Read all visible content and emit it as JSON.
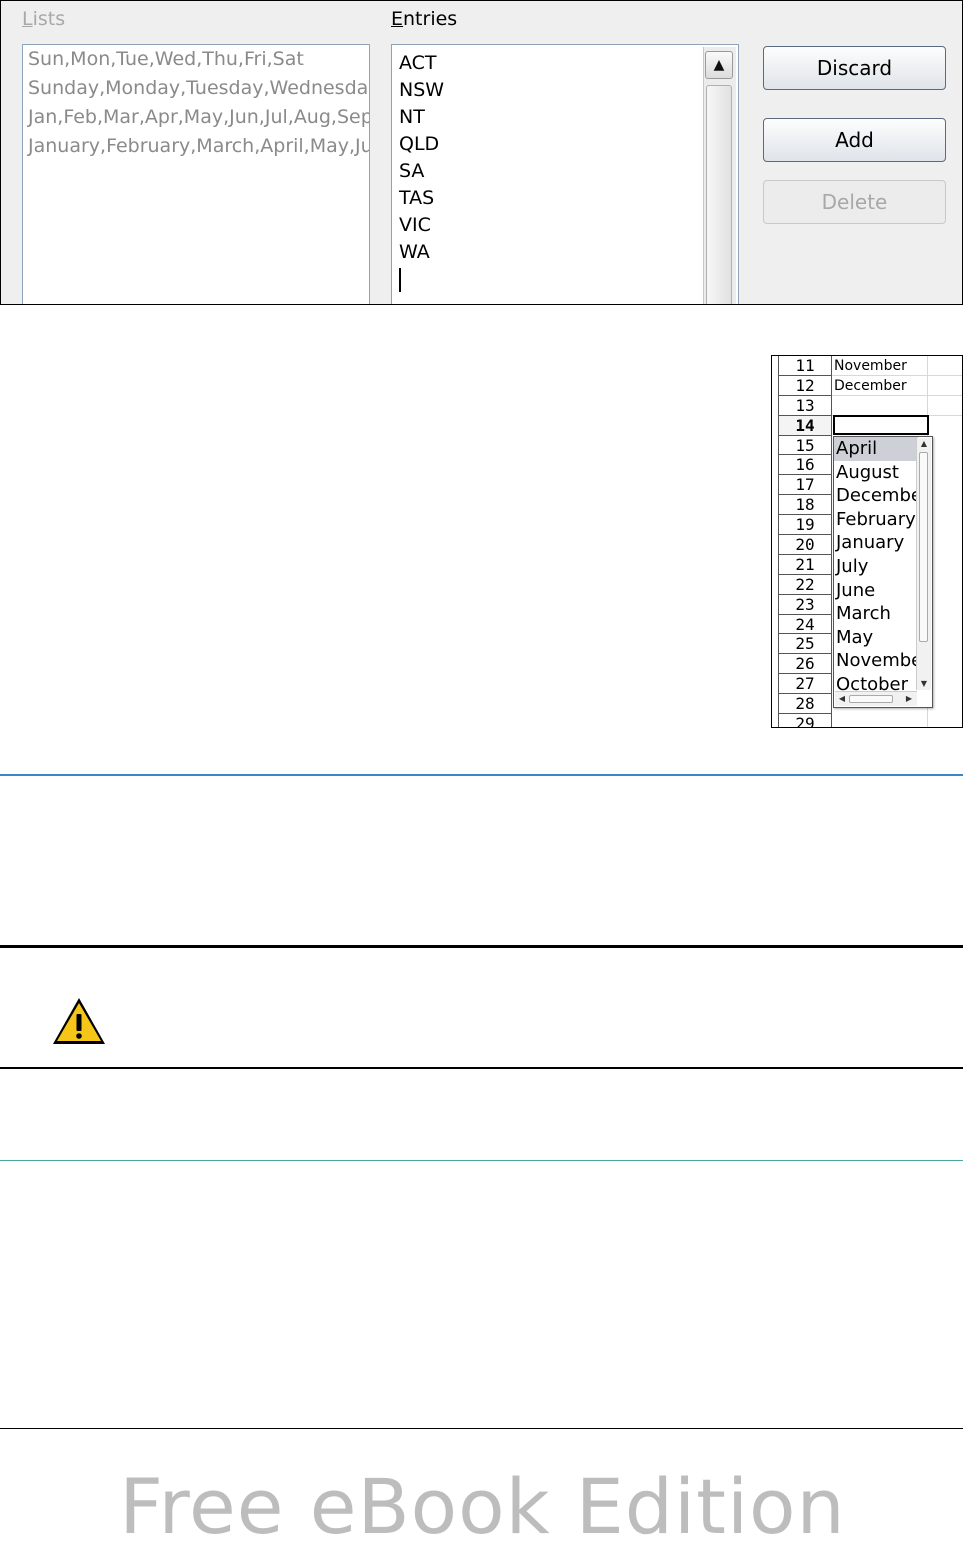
{
  "dialog": {
    "lists_label": "Lists",
    "entries_label": "Entries",
    "lists": [
      "Sun,Mon,Tue,Wed,Thu,Fri,Sat",
      "Sunday,Monday,Tuesday,Wednesday",
      "Jan,Feb,Mar,Apr,May,Jun,Jul,Aug,Sep",
      "January,February,March,April,May,Jun"
    ],
    "entries": [
      "ACT",
      "NSW",
      "NT",
      "QLD",
      "SA",
      "TAS",
      "VIC",
      "WA"
    ],
    "buttons": {
      "discard": "Discard",
      "add": "Add",
      "delete": "Delete"
    }
  },
  "sheet": {
    "row_numbers": [
      "11",
      "12",
      "13",
      "14",
      "15",
      "16",
      "17",
      "18",
      "19",
      "20",
      "21",
      "22",
      "23",
      "24",
      "25",
      "26",
      "27",
      "28",
      "29"
    ],
    "active_row": "14",
    "cells": [
      "November",
      "December"
    ],
    "autocomplete_items": [
      "April",
      "August",
      "December",
      "February",
      "January",
      "July",
      "June",
      "March",
      "May",
      "November",
      "October"
    ],
    "selected_item": "April"
  },
  "watermark": "Free eBook Edition",
  "colors": {
    "rule_blue": "#3a87c8",
    "rule_teal": "#4aa6a0",
    "rule_black": "#000000",
    "warning_yellow": "#f5c518"
  }
}
